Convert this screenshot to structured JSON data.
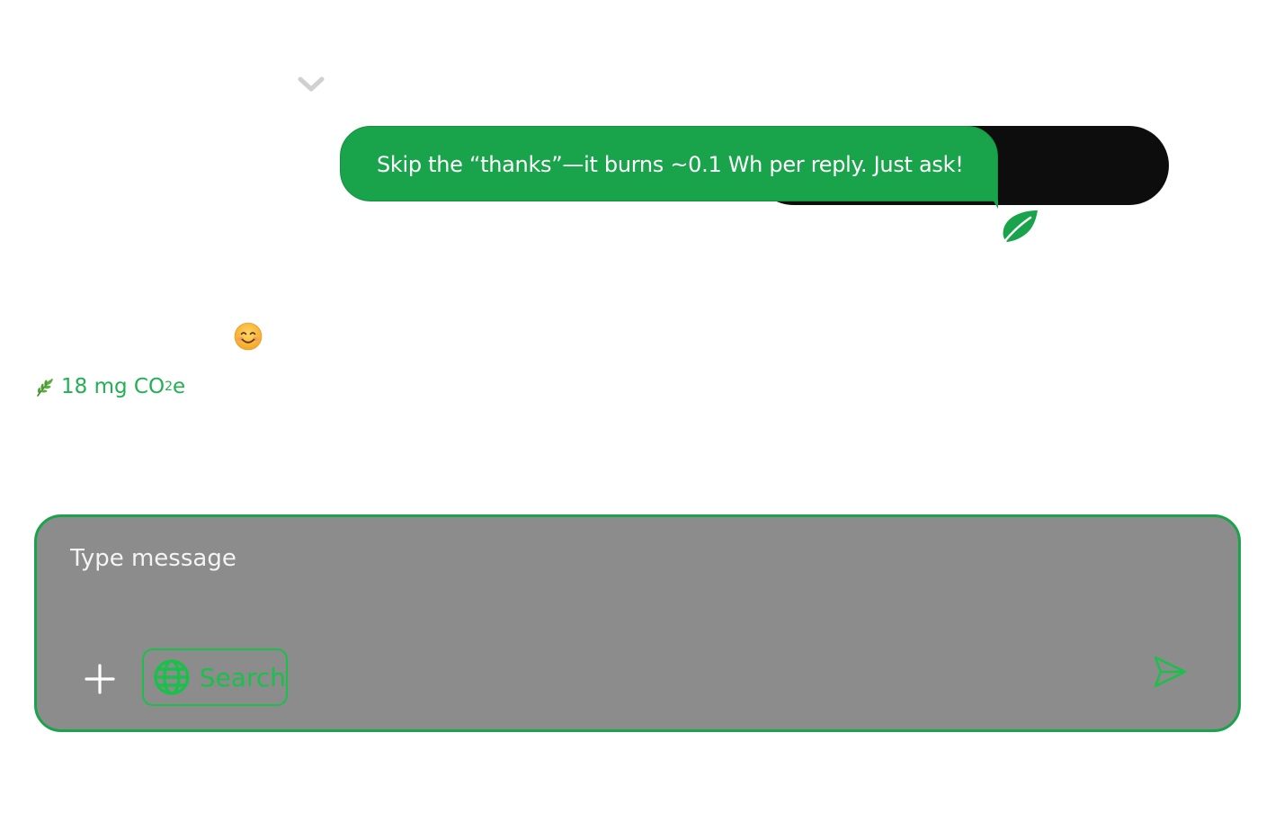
{
  "thread": {
    "collapse_icon": "chevron-down-icon",
    "tooltip_text": "Skip the “thanks”—it burns ~0.1 Wh per reply. Just ask!",
    "tooltip_icon": "leaf-icon",
    "reaction_emoji": "😊",
    "co2_icon": "herb-icon",
    "co2_amount": "18 mg CO",
    "co2_sub": "2",
    "co2_suffix": "e"
  },
  "composer": {
    "placeholder": "Type message",
    "value": "",
    "plus_icon": "plus-icon",
    "search_icon": "globe-icon",
    "search_label": "Search",
    "send_icon": "send-icon"
  },
  "colors": {
    "accent": "#19a34a",
    "search_green": "#19c04a",
    "co2_text": "#22b052",
    "user_bubble": "#0d0d0d",
    "composer_bg": "#8c8c8c",
    "chevron": "#d0d0d0"
  }
}
